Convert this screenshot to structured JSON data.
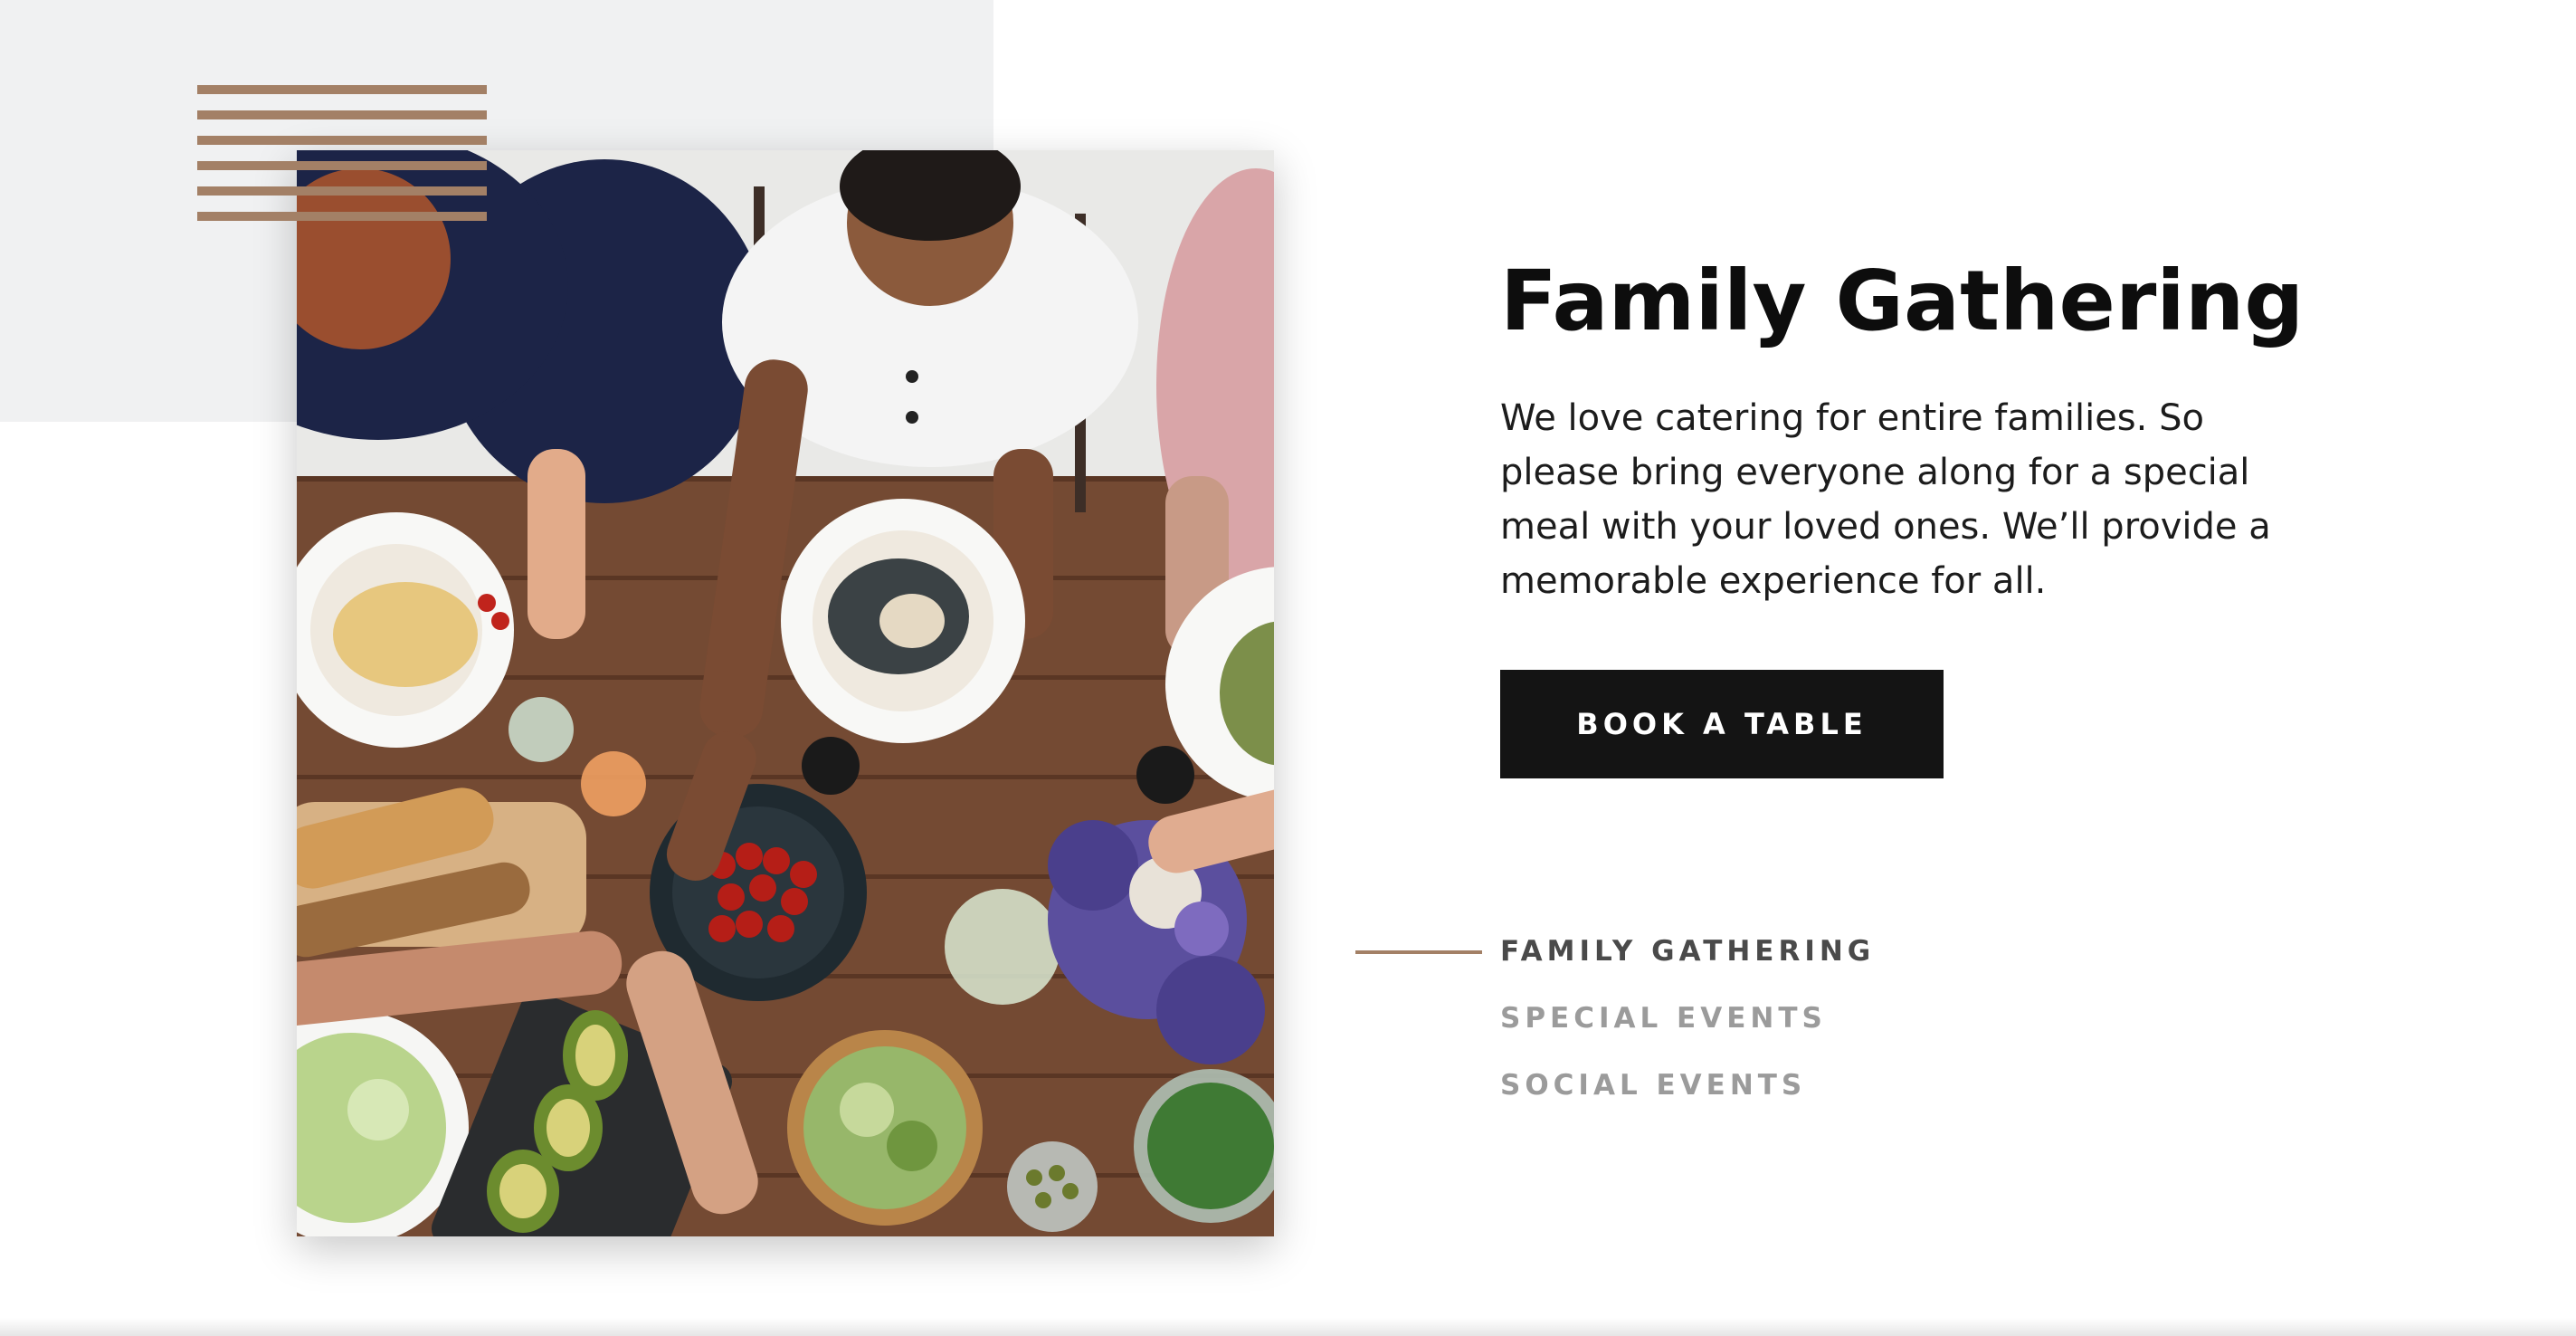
{
  "hero": {
    "title": "Family Gathering",
    "description": "We love catering for entire families. So please bring everyone along for a special meal with your loved ones. We’ll provide a memorable experience for all.",
    "cta_label": "BOOK A TABLE"
  },
  "tabs": [
    {
      "label": "FAMILY GATHERING",
      "active": true
    },
    {
      "label": "SPECIAL EVENTS",
      "active": false
    },
    {
      "label": "SOCIAL EVENTS",
      "active": false
    }
  ],
  "colors": {
    "accent": "#a38066",
    "button_bg": "#141414",
    "panel_bg": "#f0f1f2",
    "tab_active": "#4a4a4a",
    "tab_inactive": "#9b9b9b"
  },
  "photo": {
    "subject": "overhead view of a family dinner table"
  }
}
